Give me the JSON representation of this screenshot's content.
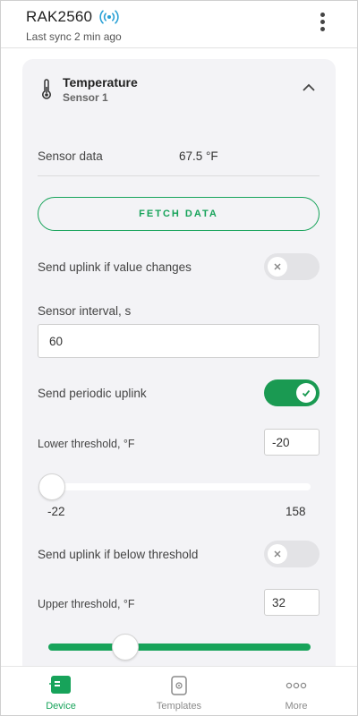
{
  "header": {
    "device_name": "RAK2560",
    "sync_status": "Last sync 2 min ago",
    "signal_icon": "radio-signal-icon",
    "menu_icon": "more-vert-icon"
  },
  "sensor_card": {
    "title": "Temperature",
    "subtitle": "Sensor 1",
    "icon": "thermometer-icon",
    "collapse_icon": "chevron-up-icon",
    "sensor_data_label": "Sensor data",
    "sensor_data_value": "67.5 °F",
    "fetch_button": "FETCH DATA",
    "uplink_on_change": {
      "label": "Send uplink if value changes",
      "enabled": false
    },
    "interval": {
      "label": "Sensor interval, s",
      "value": "60"
    },
    "periodic_uplink": {
      "label": "Send periodic uplink",
      "enabled": true
    },
    "lower_threshold": {
      "label": "Lower threshold, °F",
      "value": "-20",
      "min_label": "-22",
      "max_label": "158",
      "min": -22,
      "max": 158
    },
    "uplink_below": {
      "label": "Send uplink if below threshold",
      "enabled": false
    },
    "upper_threshold": {
      "label": "Upper threshold, °F",
      "value": "32"
    }
  },
  "bottom_nav": {
    "items": [
      {
        "label": "Device",
        "icon": "device-icon",
        "active": true
      },
      {
        "label": "Templates",
        "icon": "templates-icon",
        "active": false
      },
      {
        "label": "More",
        "icon": "more-horiz-icon",
        "active": false
      }
    ]
  },
  "colors": {
    "accent": "#17a35a",
    "card_bg": "#f3f3f6",
    "toggle_off": "#e3e3e6",
    "nav_inactive": "#8a8a8a"
  }
}
